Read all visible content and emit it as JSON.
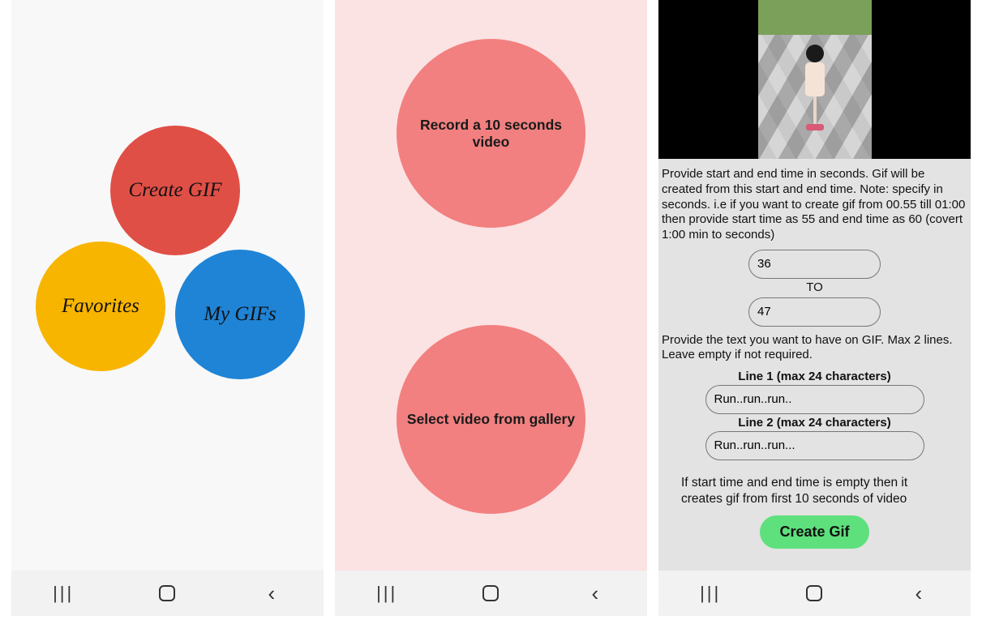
{
  "screen1": {
    "create_gif": "Create GIF",
    "favorites": "Favorites",
    "my_gifs": "My GIFs"
  },
  "screen2": {
    "record_label": "Record a 10 seconds video",
    "select_label": "Select video from gallery"
  },
  "screen3": {
    "instruction_time": "Provide start and end time in seconds. Gif will be created from this start and end time. Note: specify in seconds. i.e if you want to create gif from 00.55 till 01:00 then provide start time as 55 and end time as 60 (covert 1:00 min to seconds)",
    "start_value": "36",
    "to_label": "TO",
    "end_value": "47",
    "instruction_text": "Provide the text you want to have on GIF. Max 2 lines. Leave empty if not required.",
    "line1_label": "Line 1 (max 24 characters)",
    "line1_value": "Run..run..run..",
    "line2_label": "Line 2 (max 24 characters)",
    "line2_value": "Run..run..run...",
    "empty_hint": "If start time and end time is empty then it creates gif from first 10 seconds of video",
    "create_button": "Create Gif"
  },
  "nav": {
    "recent": "|||",
    "home": "",
    "back": "‹"
  }
}
